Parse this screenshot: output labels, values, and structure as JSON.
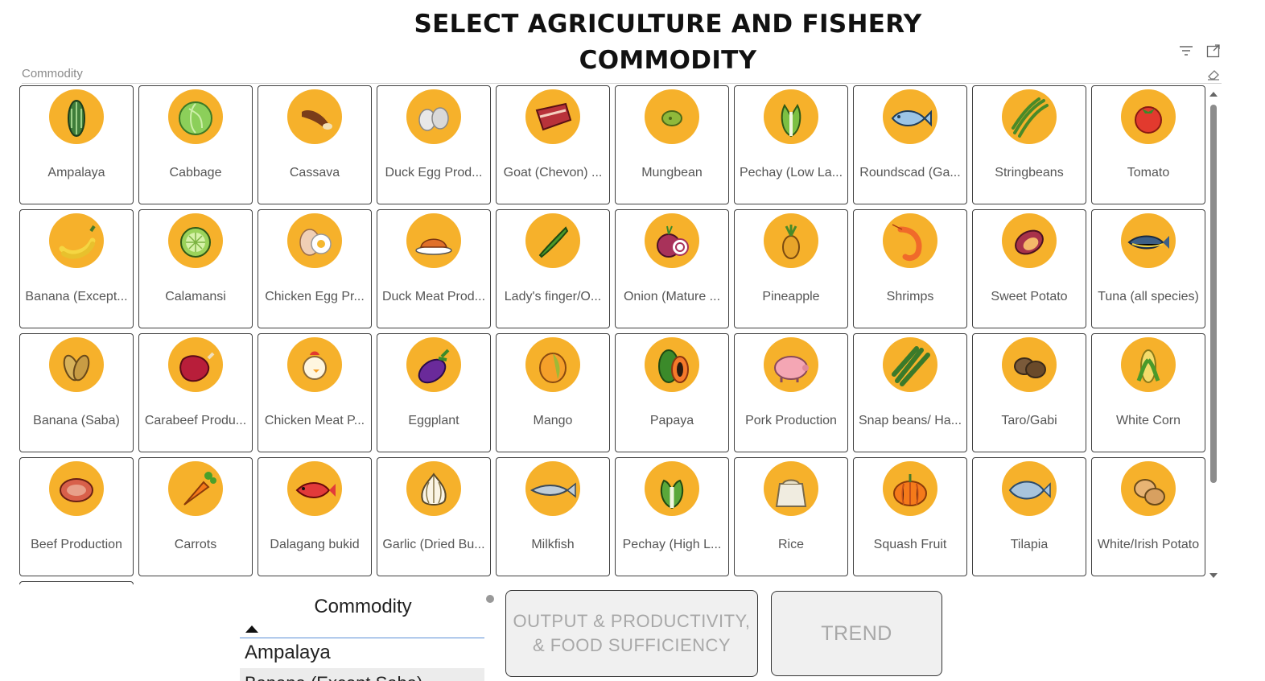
{
  "page": {
    "title_line1": "SELECT AGRICULTURE AND FISHERY",
    "title_line2": "COMMODITY"
  },
  "slicer": {
    "label": "Commodity",
    "tiles": [
      {
        "label": "Ampalaya",
        "icon": "bitter-gourd"
      },
      {
        "label": "Cabbage",
        "icon": "cabbage"
      },
      {
        "label": "Cassava",
        "icon": "cassava"
      },
      {
        "label": "Duck Egg Prod...",
        "icon": "duck-egg"
      },
      {
        "label": "Goat (Chevon) ...",
        "icon": "goat-meat"
      },
      {
        "label": "Mungbean",
        "icon": "mungbean"
      },
      {
        "label": "Pechay (Low La...",
        "icon": "pechay"
      },
      {
        "label": "Roundscad (Ga...",
        "icon": "fish"
      },
      {
        "label": "Stringbeans",
        "icon": "stringbeans"
      },
      {
        "label": "Tomato",
        "icon": "tomato"
      },
      {
        "label": "Banana (Except...",
        "icon": "banana"
      },
      {
        "label": "Calamansi",
        "icon": "calamansi"
      },
      {
        "label": "Chicken Egg Pr...",
        "icon": "chicken-egg"
      },
      {
        "label": "Duck Meat Prod...",
        "icon": "duck-meat"
      },
      {
        "label": "Lady's finger/O...",
        "icon": "okra"
      },
      {
        "label": "Onion (Mature ...",
        "icon": "onion"
      },
      {
        "label": "Pineapple",
        "icon": "pineapple"
      },
      {
        "label": "Shrimps",
        "icon": "shrimp"
      },
      {
        "label": "Sweet Potato",
        "icon": "sweet-potato"
      },
      {
        "label": "Tuna (all species)",
        "icon": "tuna"
      },
      {
        "label": "Banana (Saba)",
        "icon": "saba-banana"
      },
      {
        "label": "Carabeef Produ...",
        "icon": "carabeef"
      },
      {
        "label": "Chicken Meat P...",
        "icon": "chicken"
      },
      {
        "label": "Eggplant",
        "icon": "eggplant"
      },
      {
        "label": "Mango",
        "icon": "mango"
      },
      {
        "label": "Papaya",
        "icon": "papaya"
      },
      {
        "label": "Pork Production",
        "icon": "pig"
      },
      {
        "label": "Snap beans/ Ha...",
        "icon": "snap-beans"
      },
      {
        "label": "Taro/Gabi",
        "icon": "taro"
      },
      {
        "label": "White Corn",
        "icon": "corn"
      },
      {
        "label": "Beef Production",
        "icon": "beef"
      },
      {
        "label": "Carrots",
        "icon": "carrot"
      },
      {
        "label": "Dalagang bukid",
        "icon": "red-fish"
      },
      {
        "label": "Garlic (Dried Bu...",
        "icon": "garlic"
      },
      {
        "label": "Milkfish",
        "icon": "milkfish"
      },
      {
        "label": "Pechay (High L...",
        "icon": "pechay-high"
      },
      {
        "label": "Rice",
        "icon": "rice-sack"
      },
      {
        "label": "Squash Fruit",
        "icon": "squash"
      },
      {
        "label": "Tilapia",
        "icon": "tilapia"
      },
      {
        "label": "White/Irish Potato",
        "icon": "potato"
      }
    ]
  },
  "list_slicer": {
    "header": "Commodity",
    "selected": "Ampalaya",
    "next": "Banana (Except Saba)"
  },
  "buttons": {
    "output_label": "OUTPUT & PRODUCTIVITY, & FOOD SUFFICIENCY",
    "trend_label": "TREND"
  },
  "colors": {
    "icon_circle": "#f6b12b",
    "accent_blue": "#5a8fd6"
  }
}
